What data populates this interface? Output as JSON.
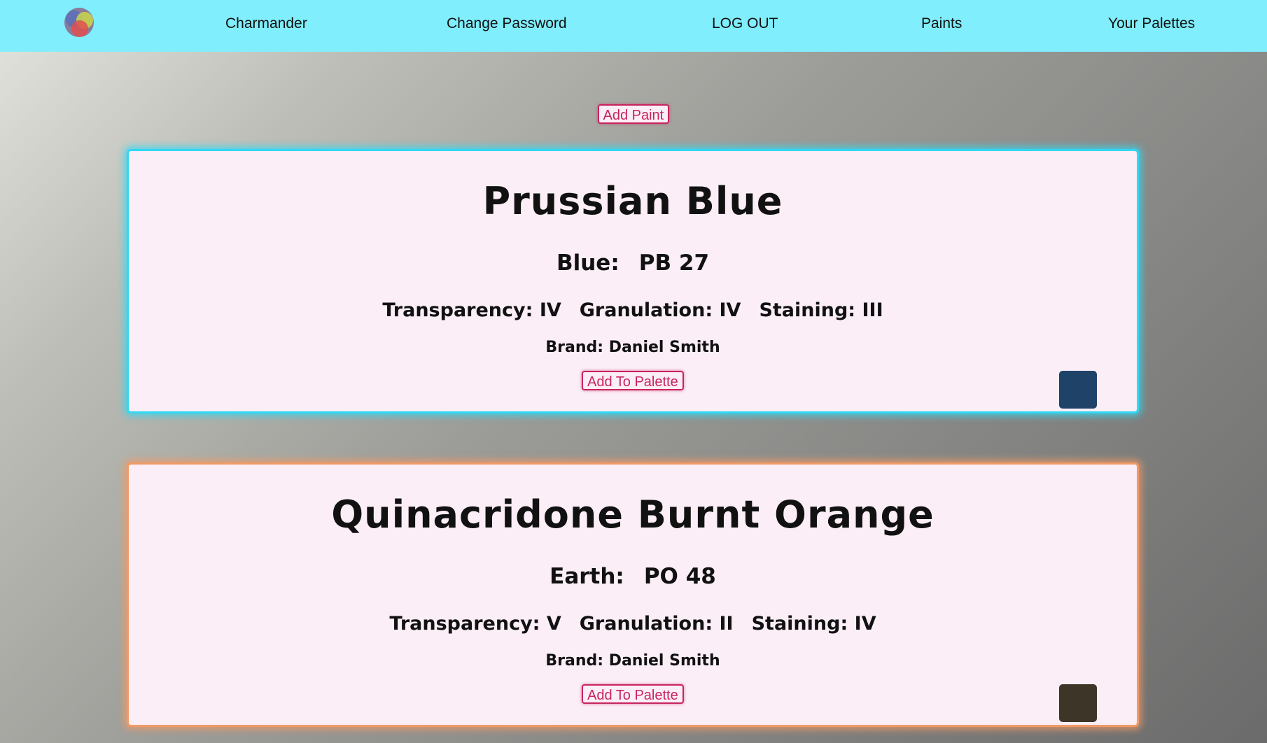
{
  "navbar": {
    "logo": "color-wheel-logo",
    "items": [
      {
        "label": "Charmander"
      },
      {
        "label": "Change Password"
      },
      {
        "label": "LOG OUT"
      },
      {
        "label": "Paints"
      },
      {
        "label": "Your Palettes"
      }
    ],
    "background": "#80eefc"
  },
  "add_paint_label": "Add Paint",
  "paints": [
    {
      "name": "Prussian Blue",
      "family": "Blue:",
      "pigment": "PB 27",
      "transparency": "Transparency: IV",
      "granulation": "Granulation: IV",
      "staining": "Staining: III",
      "brand": "Brand: Daniel Smith",
      "add_label": "Add To Palette",
      "swatch_color": "#1e4268",
      "glow_color": "#33d7f2"
    },
    {
      "name": "Quinacridone Burnt Orange",
      "family": "Earth:",
      "pigment": "PO 48",
      "transparency": "Transparency: V",
      "granulation": "Granulation: II",
      "staining": "Staining: IV",
      "brand": "Brand: Daniel Smith",
      "add_label": "Add To Palette",
      "swatch_color": "#3d3528",
      "glow_color": "#f09a66"
    }
  ]
}
